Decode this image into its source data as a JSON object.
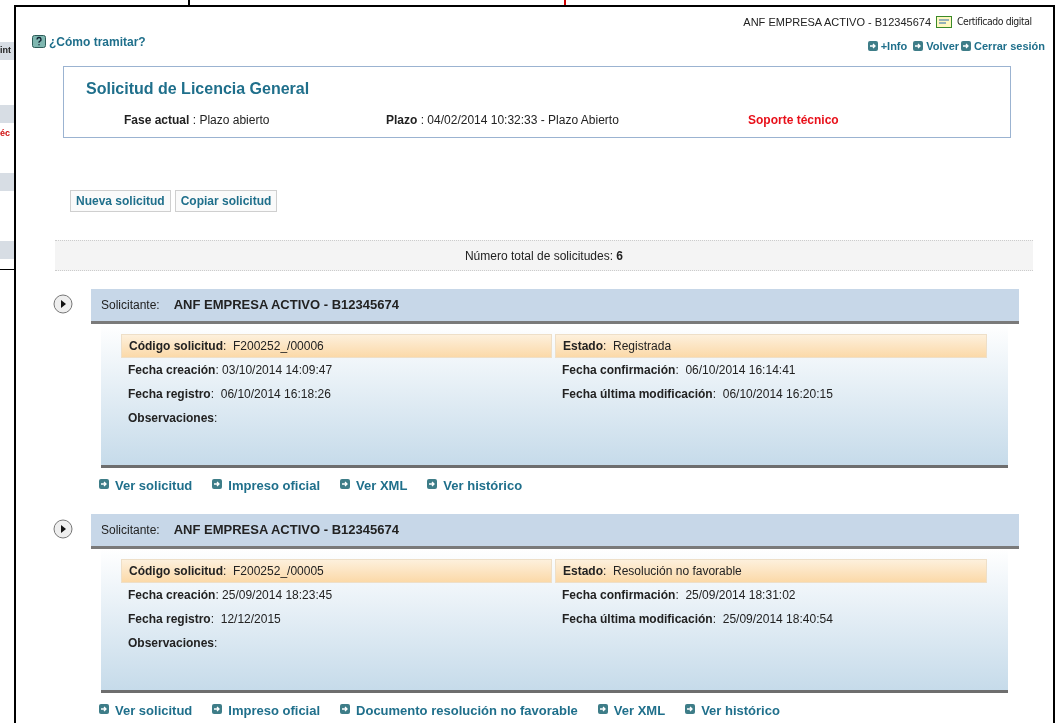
{
  "background_window": {
    "fragments": [
      "int",
      "éc"
    ]
  },
  "header": {
    "help_link": "¿Cómo tramitar?",
    "user": "ANF EMPRESA ACTIVO - B12345674",
    "certificate": "Certificado digital",
    "links": [
      "+Info",
      "Volver",
      "Cerrar sesión"
    ]
  },
  "summary": {
    "title": "Solicitud de Licencia General",
    "phase": "**Fase actual** : Plazo abierto",
    "deadline": "**Plazo** : 04/02/2014 10:32:33 - Plazo Abierto",
    "support_link": "Soporte técnico"
  },
  "buttons": [
    "Nueva solicitud",
    "Copiar solicitud"
  ],
  "total": "Número total de solicitudes: **6**",
  "records": [
    {
      "applicant_label": "Solicitante:",
      "applicant": "ANF EMPRESA ACTIVO  - B12345674",
      "fields": [
        {
          "text": "**Código solicitud**:  F200252_/00006",
          "highlight": true
        },
        {
          "text": "**Estado**:  Registrada",
          "highlight": true
        },
        {
          "text": "**Fecha creación**: 03/10/2014 14:09:47",
          "highlight": false
        },
        {
          "text": "**Fecha confirmación**:  06/10/2014 16:14:41",
          "highlight": false
        },
        {
          "text": "**Fecha registro**:  06/10/2014 16:18:26",
          "highlight": false
        },
        {
          "text": "**Fecha última modificación**:  06/10/2014 16:20:15",
          "highlight": false
        },
        {
          "text": "**Observaciones**:",
          "highlight": false
        }
      ],
      "links": [
        "Ver solicitud",
        "Impreso oficial",
        "Ver XML",
        "Ver histórico"
      ]
    },
    {
      "applicant_label": "Solicitante:",
      "applicant": "ANF EMPRESA ACTIVO  - B12345674",
      "fields": [
        {
          "text": "**Código solicitud**:  F200252_/00005",
          "highlight": true
        },
        {
          "text": "**Estado**:  Resolución no favorable",
          "highlight": true
        },
        {
          "text": "**Fecha creación**: 25/09/2014 18:23:45",
          "highlight": false
        },
        {
          "text": "**Fecha confirmación**:  25/09/2014 18:31:02",
          "highlight": false
        },
        {
          "text": "**Fecha registro**:  12/12/2015",
          "highlight": false
        },
        {
          "text": "**Fecha última modificación**:  25/09/2014 18:40:54",
          "highlight": false
        },
        {
          "text": "**Observaciones**:",
          "highlight": false
        }
      ],
      "links": [
        "Ver solicitud",
        "Impreso oficial",
        "Documento resolución no favorable",
        "Ver XML",
        "Ver histórico"
      ]
    }
  ]
}
